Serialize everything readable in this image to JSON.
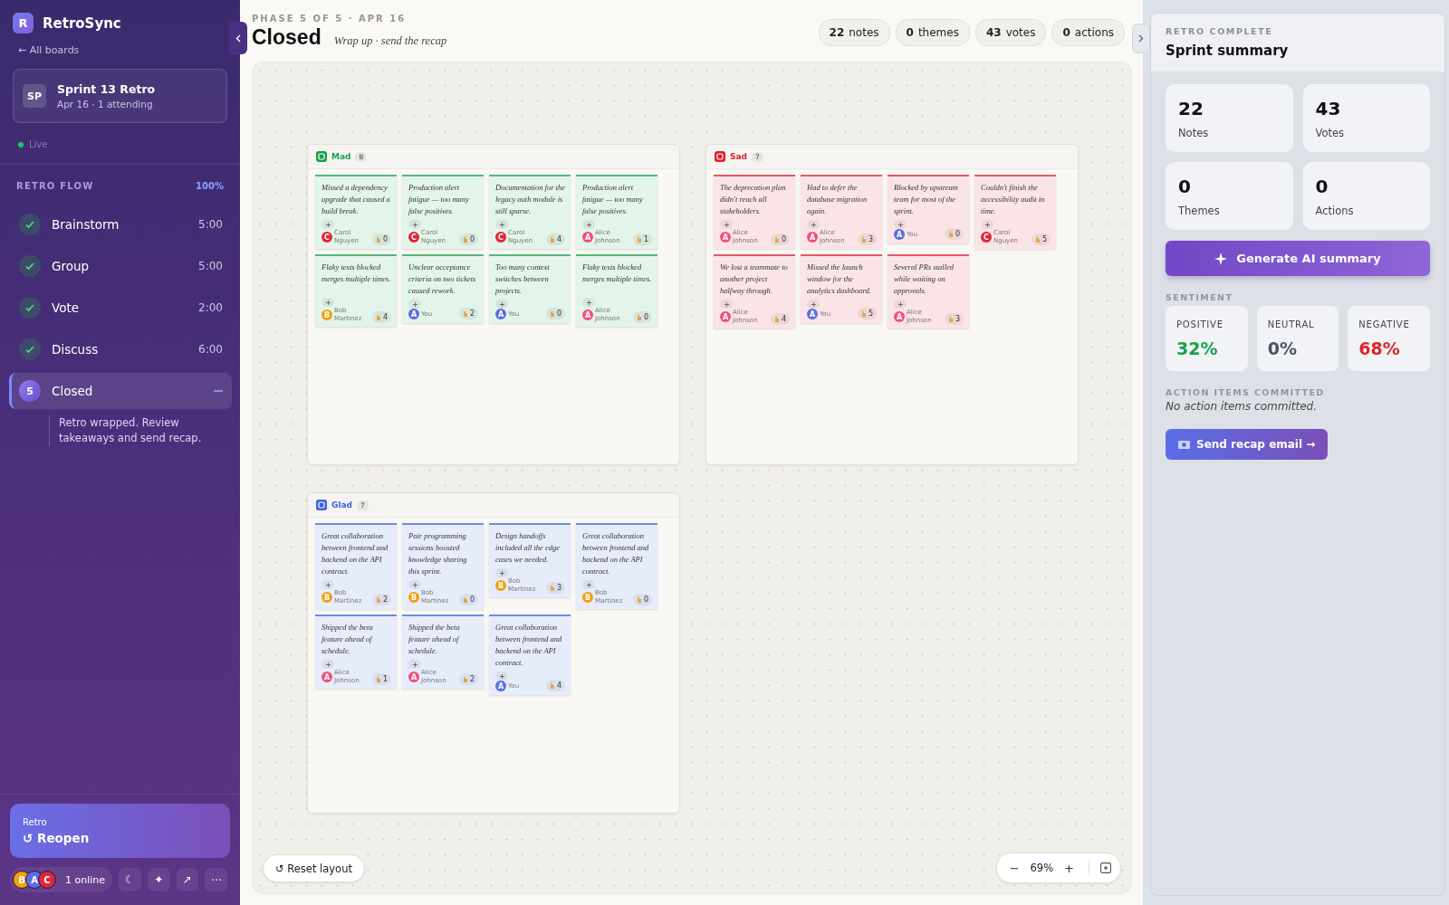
{
  "sidebar": {
    "logo": "R",
    "app_name": "RetroSync",
    "back_link": "← All boards",
    "board": {
      "initials": "SP",
      "title": "Sprint 13 Retro",
      "meta": "Apr 16 · 1 attending"
    },
    "status": {
      "label": "Live",
      "live": true
    },
    "flow_title": "RETRO FLOW",
    "flow_progress": "100%",
    "phases": [
      {
        "label": "Brainstorm",
        "time": "5:00",
        "done": true,
        "selected": false
      },
      {
        "label": "Group",
        "time": "5:00",
        "done": true,
        "selected": false
      },
      {
        "label": "Vote",
        "time": "2:00",
        "done": true,
        "selected": false
      },
      {
        "label": "Discuss",
        "time": "6:00",
        "done": true,
        "selected": false
      },
      {
        "label": "Closed",
        "number": "5",
        "done": false,
        "selected": true,
        "expanded": true,
        "description": "Retro wrapped. Review takeaways and send recap."
      }
    ],
    "reopen": {
      "caption": "Retro",
      "label": "↺ Reopen"
    },
    "online": {
      "avatars": [
        {
          "initial": "B",
          "color": "#f59e0b"
        },
        {
          "initial": "A",
          "color": "#5b6ee8"
        },
        {
          "initial": "C",
          "color": "#e0263a"
        }
      ],
      "label": "1 online"
    },
    "tools": [
      "☾",
      "✦",
      "↗",
      "⋯"
    ]
  },
  "header": {
    "phase": "PHASE 5 OF 5 · APR 16",
    "title": "Closed",
    "subtitle": "Wrap up · send the recap",
    "stats": [
      {
        "value": "22",
        "label": "notes"
      },
      {
        "value": "0",
        "label": "themes"
      },
      {
        "value": "43",
        "label": "votes"
      },
      {
        "value": "0",
        "label": "actions"
      }
    ]
  },
  "columns": [
    {
      "name": "Mad",
      "count": "8",
      "color": "#16a34a",
      "kind": "mad",
      "notes": [
        {
          "text": "Missed a dependency upgrade that caused a build break.",
          "author": "Carol Nguyen",
          "initial": "C",
          "color": "#e0263a",
          "votes": "0"
        },
        {
          "text": "Production alert fatigue — too many false positives.",
          "author": "Carol Nguyen",
          "initial": "C",
          "color": "#e0263a",
          "votes": "0"
        },
        {
          "text": "Documentation for the legacy auth module is still sparse.",
          "author": "Carol Nguyen",
          "initial": "C",
          "color": "#e0263a",
          "votes": "4"
        },
        {
          "text": "Production alert fatigue — too many false positives.",
          "author": "Alice Johnson",
          "initial": "A",
          "color": "#f0507a",
          "votes": "1"
        },
        {
          "text": "Flaky tests blocked merges multiple times.",
          "author": "Bob Martinez",
          "initial": "B",
          "color": "#f59e0b",
          "votes": "4"
        },
        {
          "text": "Unclear acceptance criteria on two tickets caused rework.",
          "author": "You",
          "initial": "A",
          "color": "#5b6ee8",
          "votes": "2"
        },
        {
          "text": "Too many context switches between projects.",
          "author": "You",
          "initial": "A",
          "color": "#5b6ee8",
          "votes": "0"
        },
        {
          "text": "Flaky tests blocked merges multiple times.",
          "author": "Alice Johnson",
          "initial": "A",
          "color": "#f0507a",
          "votes": "0"
        }
      ]
    },
    {
      "name": "Sad",
      "count": "7",
      "color": "#e11d2e",
      "kind": "sad",
      "notes": [
        {
          "text": "The deprecation plan didn't reach all stakeholders.",
          "author": "Alice Johnson",
          "initial": "A",
          "color": "#f0507a",
          "votes": "0"
        },
        {
          "text": "Had to defer the database migration again.",
          "author": "Alice Johnson",
          "initial": "A",
          "color": "#f0507a",
          "votes": "3"
        },
        {
          "text": "Blocked by upstream team for most of the sprint.",
          "author": "You",
          "initial": "A",
          "color": "#5b6ee8",
          "votes": "0"
        },
        {
          "text": "Couldn't finish the accessibility audit in time.",
          "author": "Carol Nguyen",
          "initial": "C",
          "color": "#e0263a",
          "votes": "5"
        },
        {
          "text": "We lost a teammate to another project halfway through.",
          "author": "Alice Johnson",
          "initial": "A",
          "color": "#f0507a",
          "votes": "4"
        },
        {
          "text": "Missed the launch window for the analytics dashboard.",
          "author": "You",
          "initial": "A",
          "color": "#5b6ee8",
          "votes": "5"
        },
        {
          "text": "Several PRs stalled while waiting on approvals.",
          "author": "Alice Johnson",
          "initial": "A",
          "color": "#f0507a",
          "votes": "3"
        }
      ]
    },
    {
      "name": "Glad",
      "count": "7",
      "color": "#3b63e0",
      "kind": "glad",
      "notes": [
        {
          "text": "Great collaboration between frontend and backend on the API contract.",
          "author": "Bob Martinez",
          "initial": "B",
          "color": "#f59e0b",
          "votes": "2"
        },
        {
          "text": "Pair programming sessions boosted knowledge sharing this sprint.",
          "author": "Bob Martinez",
          "initial": "B",
          "color": "#f59e0b",
          "votes": "0"
        },
        {
          "text": "Design handoffs included all the edge cases we needed.",
          "author": "Bob Martinez",
          "initial": "B",
          "color": "#f59e0b",
          "votes": "3"
        },
        {
          "text": "Great collaboration between frontend and backend on the API contract.",
          "author": "Bob Martinez",
          "initial": "B",
          "color": "#f59e0b",
          "votes": "0"
        },
        {
          "text": "Shipped the beta feature ahead of schedule.",
          "author": "Alice Johnson",
          "initial": "A",
          "color": "#f0507a",
          "votes": "1"
        },
        {
          "text": "Shipped the beta feature ahead of schedule.",
          "author": "Alice Johnson",
          "initial": "A",
          "color": "#f0507a",
          "votes": "2"
        },
        {
          "text": "Great collaboration between frontend and backend on the API contract.",
          "author": "You",
          "initial": "A",
          "color": "#5b6ee8",
          "votes": "4"
        }
      ]
    }
  ],
  "canvas_toolbar": {
    "reset": "↺ Reset layout",
    "zoom_out": "−",
    "zoom": "69%",
    "zoom_in": "+"
  },
  "summary": {
    "eyebrow": "RETRO COMPLETE",
    "title": "Sprint summary",
    "stats": [
      {
        "value": "22",
        "label": "Notes"
      },
      {
        "value": "43",
        "label": "Votes"
      },
      {
        "value": "0",
        "label": "Themes"
      },
      {
        "value": "0",
        "label": "Actions"
      }
    ],
    "generate": "Generate AI summary",
    "sentiment_title": "SENTIMENT",
    "sentiment": [
      {
        "label": "POSITIVE",
        "value": "32%",
        "kind": "positive"
      },
      {
        "label": "NEUTRAL",
        "value": "0%",
        "kind": "neutral"
      },
      {
        "label": "NEGATIVE",
        "value": "68%",
        "kind": "negative"
      }
    ],
    "actions_title": "ACTION ITEMS COMMITTED",
    "actions_empty": "No action items committed.",
    "send": "Send recap email →"
  }
}
